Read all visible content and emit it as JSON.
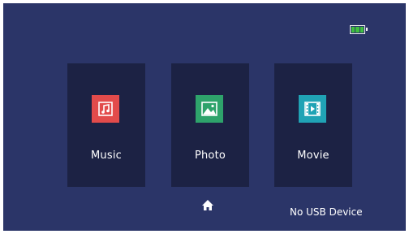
{
  "status_bar": {
    "battery_icon": "battery-icon",
    "battery_level": 1.0
  },
  "menu": {
    "items": [
      {
        "label": "Music",
        "icon": "music-note-icon",
        "color": "#e24b4b"
      },
      {
        "label": "Photo",
        "icon": "photo-icon",
        "color": "#2ea36b"
      },
      {
        "label": "Movie",
        "icon": "film-icon",
        "color": "#20a3b5"
      }
    ]
  },
  "footer": {
    "home_icon": "home-icon",
    "status_text": "No USB Device"
  },
  "colors": {
    "background": "#2b3568",
    "tile": "#1c2244",
    "battery_fill": "#3fbf3f"
  }
}
